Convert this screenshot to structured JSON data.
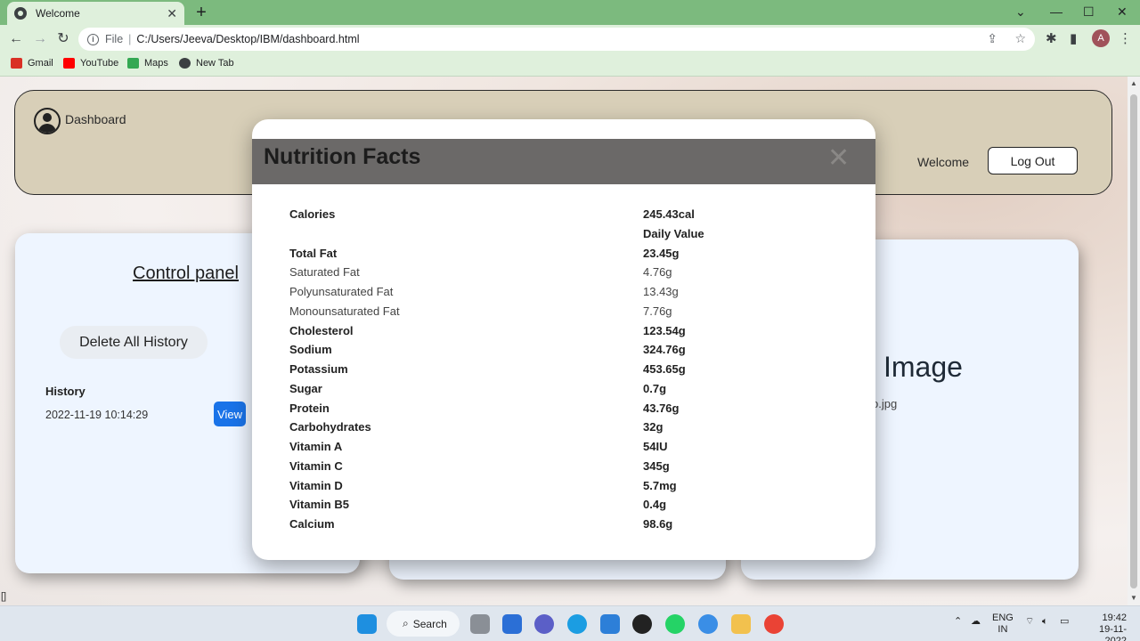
{
  "browser": {
    "tab_title": "Welcome",
    "tab_close": "✕",
    "new_tab": "+",
    "url_scheme": "File",
    "url_path": "C:/Users/Jeeva/Desktop/IBM/dashboard.html",
    "profile_initial": "A",
    "bookmarks": [
      "Gmail",
      "YouTube",
      "Maps",
      "New Tab"
    ]
  },
  "page": {
    "brand": "Dashboard",
    "welcome": "Welcome",
    "logout_label": "Log Out",
    "control_panel_title": "Control panel",
    "delete_history_label": "Delete All History",
    "history_label": "History",
    "history_items": [
      {
        "date": "2022-11-19 10:14:29",
        "action": "View"
      }
    ],
    "image_title": "Image",
    "image_filename": "o.jpg",
    "stray_text": "[]"
  },
  "modal": {
    "title": "Nutrition Facts",
    "close": "✕",
    "rows": [
      {
        "label": "Calories",
        "value": "245.43cal",
        "weight": "bold"
      },
      {
        "label": "",
        "value": "Daily Value",
        "weight": "bold"
      },
      {
        "label": "Total Fat",
        "value": "23.45g",
        "weight": "bold"
      },
      {
        "label": "Saturated Fat",
        "value": "4.76g",
        "weight": "normal"
      },
      {
        "label": "Polyunsaturated Fat",
        "value": "13.43g",
        "weight": "normal"
      },
      {
        "label": "Monounsaturated Fat",
        "value": "7.76g",
        "weight": "normal"
      },
      {
        "label": "Cholesterol",
        "value": "123.54g",
        "weight": "bold"
      },
      {
        "label": "Sodium",
        "value": "324.76g",
        "weight": "bold"
      },
      {
        "label": "Potassium",
        "value": "453.65g",
        "weight": "bold"
      },
      {
        "label": "Sugar",
        "value": "0.7g",
        "weight": "bold"
      },
      {
        "label": "Protein",
        "value": "43.76g",
        "weight": "bold"
      },
      {
        "label": "Carbohydrates",
        "value": "32g",
        "weight": "bold"
      },
      {
        "label": "Vitamin A",
        "value": "54IU",
        "weight": "bold"
      },
      {
        "label": "Vitamin C",
        "value": "345g",
        "weight": "bold"
      },
      {
        "label": "Vitamin D",
        "value": "5.7mg",
        "weight": "bold"
      },
      {
        "label": "Vitamin B5",
        "value": "0.4g",
        "weight": "bold"
      },
      {
        "label": "Calcium",
        "value": "98.6g",
        "weight": "bold"
      }
    ]
  },
  "taskbar": {
    "search_label": "Search",
    "lang_top": "ENG",
    "lang_bottom": "IN",
    "time": "19:42",
    "date": "19-11-2022"
  },
  "colors": {
    "chrome_tabbar": "#7cba7e",
    "chrome_toolbar": "#dff0dc",
    "header_box": "#d8cfb8",
    "card": "#eef5ff",
    "view_button": "#1a73e8",
    "modal_header": "#6b6968"
  }
}
